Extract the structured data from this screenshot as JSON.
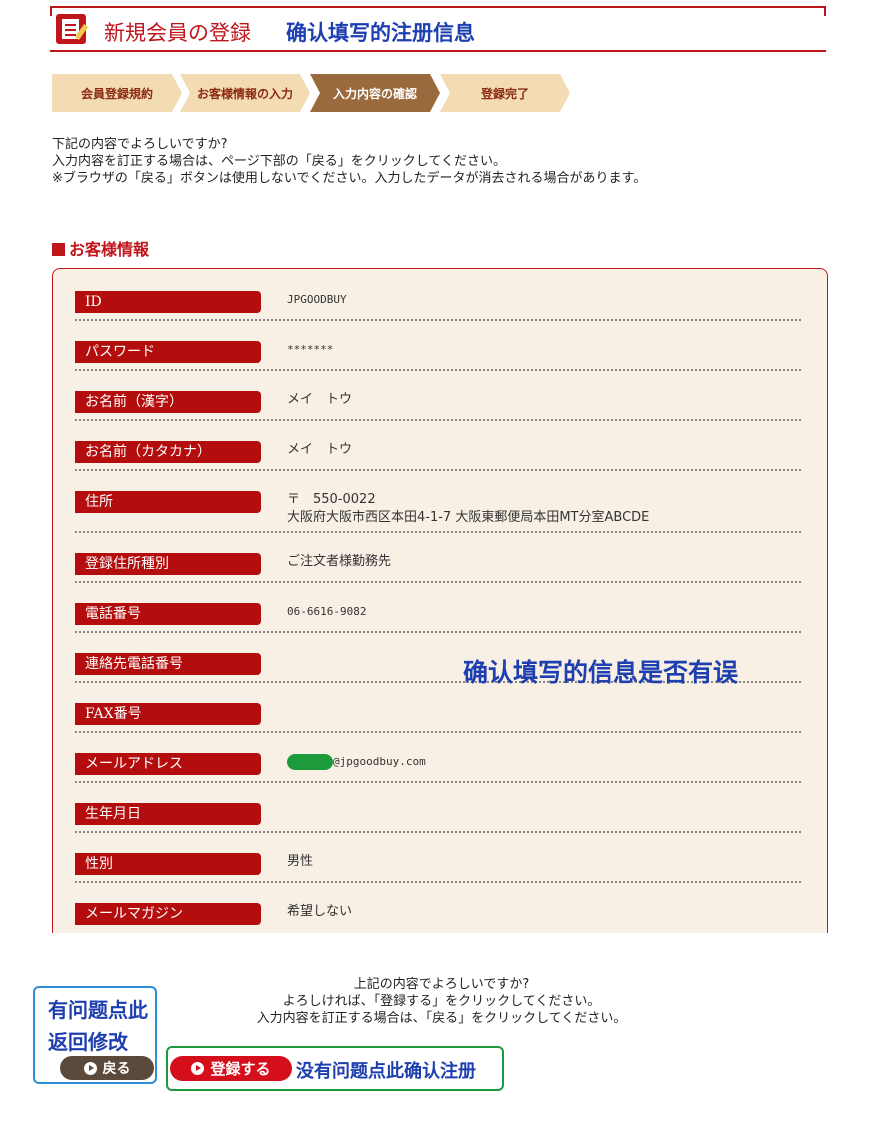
{
  "header": {
    "title": "新規会員の登録",
    "annotation": "确认填写的注册信息",
    "icon": "form-edit-icon"
  },
  "steps": [
    {
      "label": "会員登録規約",
      "active": false
    },
    {
      "label": "お客様情報の入力",
      "active": false
    },
    {
      "label": "入力内容の確認",
      "active": true
    },
    {
      "label": "登録完了",
      "active": false
    }
  ],
  "intro": {
    "line1": "下記の内容でよろしいですか?",
    "line2": "入力内容を訂正する場合は、ページ下部の「戻る」をクリックしてください。",
    "line3": "※ブラウザの「戻る」ボタンは使用しないでください。入力したデータが消去される場合があります。"
  },
  "section_title": "お客様情報",
  "fields": [
    {
      "label": "ID",
      "value": "JPGOODBUY"
    },
    {
      "label": "パスワード",
      "value": "*******"
    },
    {
      "label": "お名前（漢字）",
      "value": "メイ　トウ"
    },
    {
      "label": "お名前（カタカナ）",
      "value": "メイ　トウ"
    },
    {
      "label": "住所",
      "value": "〒　550-0022",
      "value2": "大阪府大阪市西区本田4-1-7 大阪東郵便局本田MT分室ABCDE"
    },
    {
      "label": "登録住所種別",
      "value": "ご注文者様勤務先"
    },
    {
      "label": "電話番号",
      "value": "06-6616-9082"
    },
    {
      "label": "連絡先電話番号",
      "value": ""
    },
    {
      "label": "FAX番号",
      "value": ""
    },
    {
      "label": "メールアドレス",
      "value": "@jpgoodbuy.com"
    },
    {
      "label": "生年月日",
      "value": ""
    },
    {
      "label": "性別",
      "value": "男性"
    },
    {
      "label": "メールマガジン",
      "value": "希望しない"
    }
  ],
  "panel_annotation": "确认填写的信息是否有误",
  "bottom": {
    "line1": "上記の内容でよろしいですか?",
    "line2": "よろしければ、「登録する」をクリックしてください。",
    "line3": "入力内容を訂正する場合は、「戻る」をクリックしてください。"
  },
  "back_annotation_1": "有问题点此",
  "back_annotation_2": "返回修改",
  "back_button": "戻る",
  "register_button": "登録する",
  "register_annotation": "没有问题点此确认注册",
  "colors": {
    "brand_red": "#c0151b",
    "label_red": "#b30d0d",
    "annotation_blue": "#1e3fb0",
    "panel_bg": "#f8f0e5",
    "step_active": "#9a6a3d",
    "step_inactive": "#f3dcb4"
  }
}
